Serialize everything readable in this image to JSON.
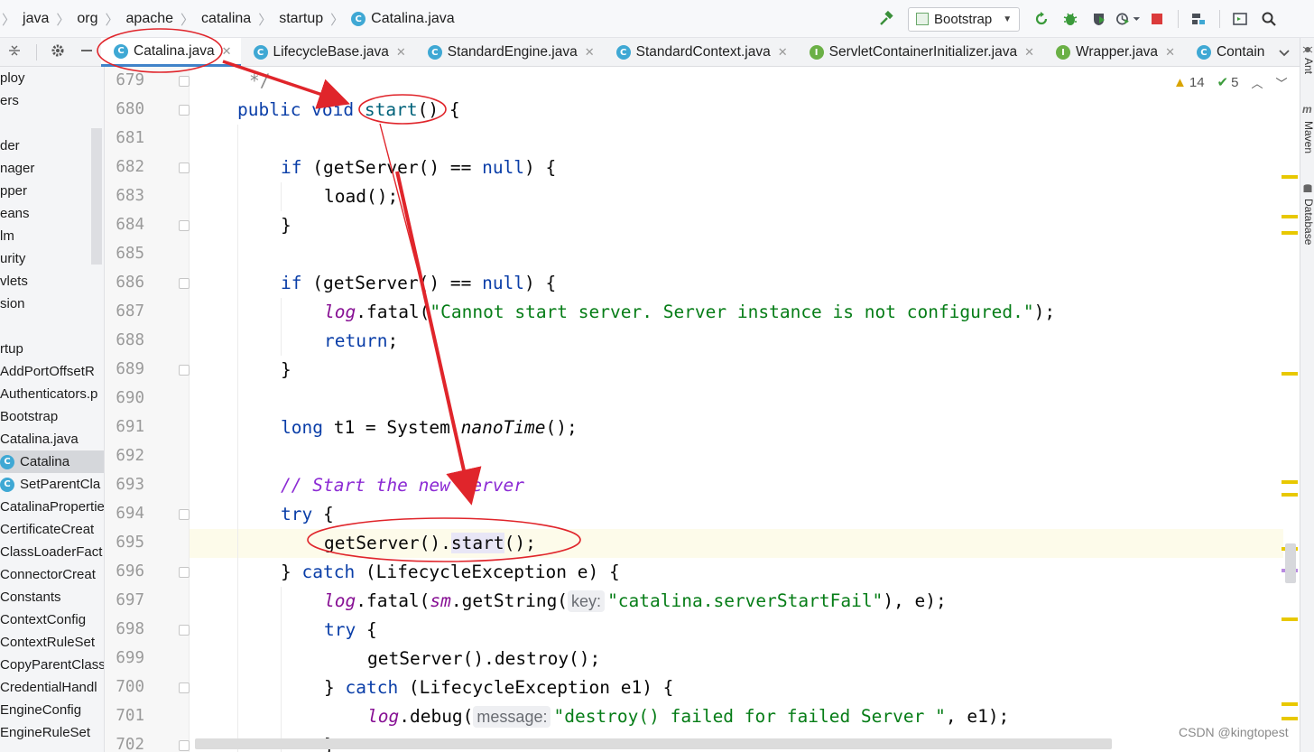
{
  "breadcrumbs": [
    "java",
    "org",
    "apache",
    "catalina",
    "startup",
    "Catalina.java"
  ],
  "run_config": {
    "label": "Bootstrap"
  },
  "tabs": [
    {
      "label": "Catalina.java",
      "kind": "C",
      "active": true
    },
    {
      "label": "LifecycleBase.java",
      "kind": "C"
    },
    {
      "label": "StandardEngine.java",
      "kind": "C"
    },
    {
      "label": "StandardContext.java",
      "kind": "C"
    },
    {
      "label": "ServletContainerInitializer.java",
      "kind": "I"
    },
    {
      "label": "Wrapper.java",
      "kind": "I"
    },
    {
      "label": "Contain",
      "kind": "C"
    }
  ],
  "project_items": [
    "ploy",
    "ers",
    "",
    "der",
    "nager",
    "pper",
    "eans",
    "lm",
    "urity",
    "vlets",
    "sion",
    "",
    "rtup",
    "AddPortOffsetR",
    "Authenticators.p",
    "Bootstrap",
    "Catalina.java",
    "Catalina",
    "SetParentCla",
    "CatalinaPropertie",
    "CertificateCreat",
    "ClassLoaderFact",
    "ConnectorCreat",
    "Constants",
    "ContextConfig",
    "ContextRuleSet",
    "CopyParentClass",
    "CredentialHandl",
    "EngineConfig",
    "EngineRuleSet"
  ],
  "line_numbers": [
    "679",
    "680",
    "681",
    "682",
    "683",
    "684",
    "685",
    "686",
    "687",
    "688",
    "689",
    "690",
    "691",
    "692",
    "693",
    "694",
    "695",
    "696",
    "697",
    "698",
    "699",
    "700",
    "701",
    "702"
  ],
  "code": {
    "l679": "*/",
    "l680_kw": "public void ",
    "l680_name": "start",
    "l680_rest": "() {",
    "l682_kw": "if",
    "l682_rest": " (getServer() == ",
    "l682_null": "null",
    "l682_end": ") {",
    "l683": "load();",
    "l684": "}",
    "l686_kw": "if",
    "l686_rest": " (getServer() == ",
    "l686_null": "null",
    "l686_end": ") {",
    "l687_log": "log",
    "l687_mid": ".fatal(",
    "l687_str": "\"Cannot start server. Server instance is not configured.\"",
    "l687_end": ");",
    "l688_kw": "return",
    "l688_end": ";",
    "l689": "}",
    "l691_kw": "long",
    "l691_mid": " t1 = System.",
    "l691_it": "nanoTime",
    "l691_end": "();",
    "l693": "// Start the new server",
    "l694_kw": "try",
    "l694_end": " {",
    "l695_a": "getServer().",
    "l695_b": "start",
    "l695_c": "();",
    "l696_a": "} ",
    "l696_kw": "catch",
    "l696_b": " (LifecycleException e) {",
    "l697_log": "log",
    "l697_a": ".fatal(",
    "l697_sm": "sm",
    "l697_b": ".getString(",
    "l697_hint": "key:",
    "l697_str": "\"catalina.serverStartFail\"",
    "l697_c": "), e);",
    "l698_kw": "try",
    "l698_end": " {",
    "l699": "getServer().destroy();",
    "l700_a": "} ",
    "l700_kw": "catch",
    "l700_b": " (LifecycleException e1) {",
    "l701_log": "log",
    "l701_a": ".debug(",
    "l701_hint": "message:",
    "l701_str": "\"destroy() failed for failed Server \"",
    "l701_c": ", e1);",
    "l702": "}"
  },
  "inspections": {
    "warnings": "14",
    "ok": "5"
  },
  "right_tools": [
    "Ant",
    "Maven",
    "Database"
  ],
  "watermark": "CSDN @kingtopest",
  "colors": {
    "keyword": "#0a3ea8",
    "string": "#067d17",
    "field": "#871094",
    "comment": "#8c2bd4",
    "annotation": "#e0252b",
    "tab_underline": "#4083c9"
  },
  "icons": [
    "hammer-icon",
    "run-icon",
    "debug-icon",
    "coverage-icon",
    "profile-icon",
    "stop-icon",
    "project-structure-icon",
    "terminal-icon",
    "search-icon",
    "settings-icon",
    "collapse-icon",
    "minimize-icon"
  ]
}
